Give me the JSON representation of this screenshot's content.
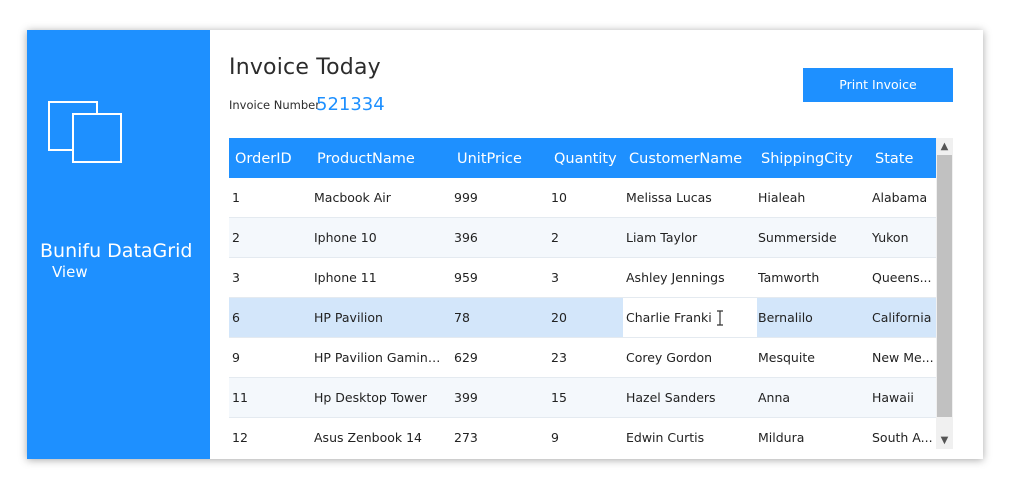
{
  "sidebar": {
    "brand_line1": "Bunifu DataGrid",
    "brand_line2": "View",
    "logo_icon": "restore-window-icon"
  },
  "header": {
    "title": "Invoice Today",
    "invoice_label": "Invoice Number",
    "invoice_number": "521334",
    "print_button": "Print Invoice"
  },
  "grid": {
    "columns": [
      "OrderID",
      "ProductName",
      "UnitPrice",
      "Quantity",
      "CustomerName",
      "ShippingCity",
      "State"
    ],
    "rows": [
      [
        "1",
        "Macbook Air",
        "999",
        "10",
        "Melissa Lucas",
        "Hialeah",
        "Alabama"
      ],
      [
        "2",
        "Iphone 10",
        "396",
        "2",
        "Liam Taylor",
        "Summerside",
        "Yukon"
      ],
      [
        "3",
        "Iphone 11",
        "959",
        "3",
        "Ashley Jennings",
        "Tamworth",
        "Queens..."
      ],
      [
        "6",
        "HP Pavilion",
        "78",
        "20",
        "Charlie Franki",
        "Bernalilo",
        "California"
      ],
      [
        "9",
        "HP Pavilion Gaming...",
        "629",
        "23",
        "Corey Gordon",
        "Mesquite",
        "New Me..."
      ],
      [
        "11",
        "Hp Desktop Tower",
        "399",
        "15",
        "Hazel Sanders",
        "Anna",
        "Hawaii"
      ],
      [
        "12",
        "Asus Zenbook 14",
        "273",
        "9",
        "Edwin Curtis",
        "Mildura",
        "South A..."
      ]
    ],
    "selected_row_index": 3,
    "editing_column": "CustomerName"
  },
  "colors": {
    "accent": "#1e90ff",
    "selected_row": "#d3e6fa",
    "alt_row": "#f4f8fc"
  }
}
